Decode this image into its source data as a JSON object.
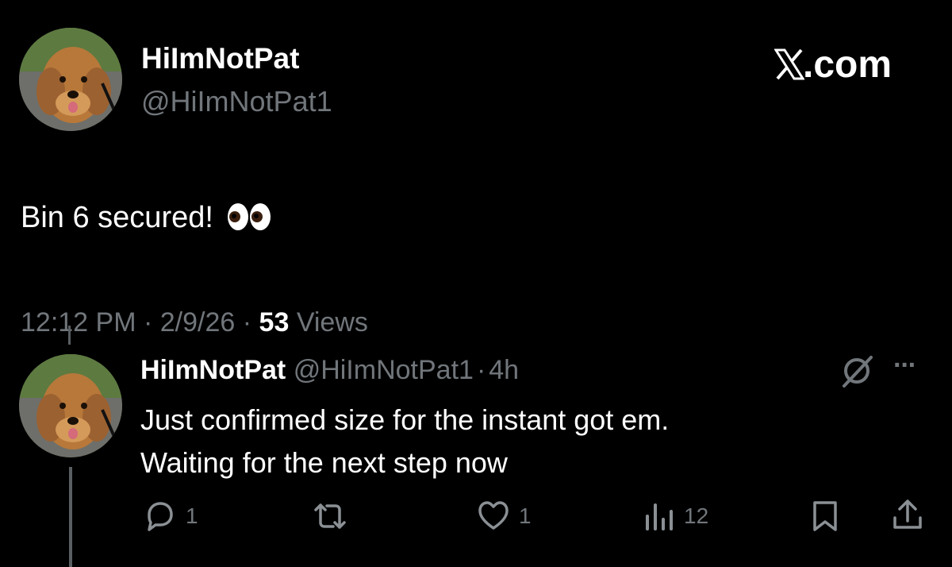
{
  "card": {
    "author_name": "HiImNotPat",
    "author_handle": "@HiImNotPat1",
    "brand": "X.com",
    "text": "Bin 6 secured!",
    "emoji": "👀",
    "time": "12:12 PM",
    "sep1": "·",
    "date": "2/9/26",
    "sep2": "·",
    "views_count": "53",
    "views_label": "Views"
  },
  "reply": {
    "author_name": "HiImNotPat",
    "author_handle": "@HiImNotPat1",
    "sep": "·",
    "age": "4h",
    "line1": "Just confirmed size for the instant got em.",
    "line2": "Waiting for the next step now",
    "more": "···",
    "stats": {
      "replies": "1",
      "likes": "1",
      "views": "12"
    }
  },
  "colors": {
    "background": "#000000",
    "text": "#e7e9ea",
    "muted": "#71767b"
  },
  "icons": [
    "avatar-dog",
    "x-logo",
    "reply-icon",
    "repost-icon",
    "like-icon",
    "views-icon",
    "bookmark-icon",
    "share-icon",
    "grok-icon",
    "more-icon"
  ]
}
